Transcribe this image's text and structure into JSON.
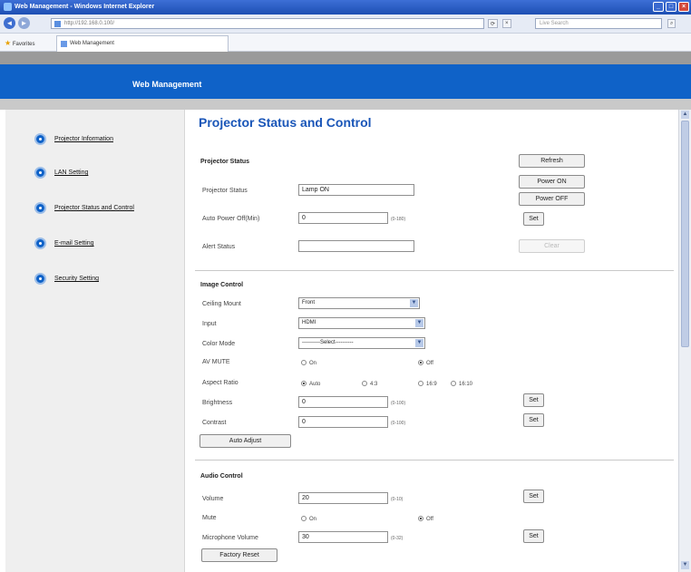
{
  "browser": {
    "window_title": "Web Management - Windows Internet Explorer",
    "address": "http://192.168.0.100/",
    "search_placeholder": "Live Search",
    "favorites_label": "Favorites",
    "tab_label": "Web Management",
    "win_buttons": [
      "_",
      "□",
      "×"
    ],
    "colors": {
      "titlebar": "#1d4fb3",
      "header": "#0f62c8"
    }
  },
  "app": {
    "header_title": "Web Management"
  },
  "sidebar": {
    "items": [
      {
        "label": "Projector Information",
        "icon": "circle-bullet-icon"
      },
      {
        "label": "LAN Setting",
        "icon": "circle-bullet-icon"
      },
      {
        "label": "Projector Status and Control",
        "icon": "circle-bullet-icon"
      },
      {
        "label": "E-mail Setting",
        "icon": "circle-bullet-icon"
      },
      {
        "label": "Security Setting",
        "icon": "circle-bullet-icon"
      }
    ]
  },
  "main": {
    "title": "Projector Status and Control",
    "projector_status": {
      "heading": "Projector Status",
      "status_label": "Projector Status",
      "status_value": "Lamp ON",
      "auto_power_label": "Auto Power Off(Min)",
      "auto_power_value": "0",
      "auto_power_range": "(0-180)",
      "alert_label": "Alert Status",
      "alert_value": "",
      "refresh_label": "Refresh",
      "power_on_label": "Power ON",
      "power_off_label": "Power OFF",
      "set_label": "Set",
      "clear_label": "Clear"
    },
    "image_control": {
      "heading": "Image Control",
      "ceiling_label": "Ceiling Mount",
      "ceiling_value": "Front",
      "input_label": "Input",
      "input_value": "HDMI",
      "color_label": "Color Mode",
      "color_value": "----------Select----------",
      "avmute_label": "AV MUTE",
      "on_label": "On",
      "off_label": "Off",
      "aspect_label": "Aspect Ratio",
      "aspect_options": [
        "Auto",
        "4:3",
        "16:9",
        "16:10"
      ],
      "brightness_label": "Brightness",
      "brightness_value": "0",
      "brightness_range": "(0-100)",
      "contrast_label": "Contrast",
      "contrast_value": "0",
      "contrast_range": "(0-100)",
      "set_label": "Set",
      "auto_adjust_label": "Auto Adjust"
    },
    "audio_control": {
      "heading": "Audio Control",
      "volume_label": "Volume",
      "volume_value": "20",
      "volume_range": "(0-10)",
      "mute_label": "Mute",
      "on_label": "On",
      "off_label": "Off",
      "mic_label": "Microphone Volume",
      "mic_value": "30",
      "mic_range": "(0-32)",
      "set_label": "Set",
      "factory_reset_label": "Factory Reset"
    }
  }
}
